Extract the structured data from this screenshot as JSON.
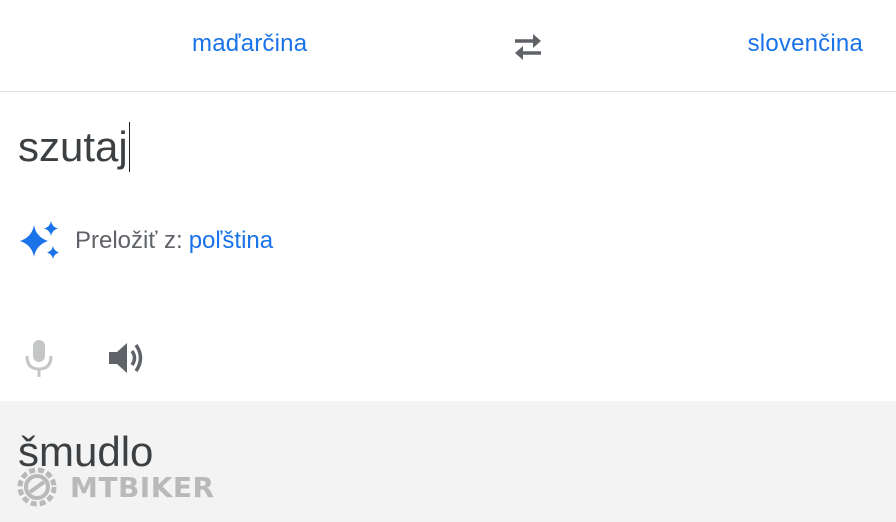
{
  "header": {
    "source_language": "maďarčina",
    "target_language": "slovenčina",
    "swap_icon": "swap-arrows-icon"
  },
  "input": {
    "text": "szutaj",
    "detected_prefix": "Preložiť z:",
    "detected_language": "poľština",
    "detect_icon": "sparkle-icon",
    "mic_icon": "microphone-icon",
    "speaker_icon": "speaker-icon"
  },
  "output": {
    "text": "šmudlo"
  },
  "watermark": {
    "text": "MTBIKER"
  },
  "colors": {
    "accent": "#1a73e8",
    "output_background": "#f3f3f3",
    "text": "#3c4043"
  }
}
